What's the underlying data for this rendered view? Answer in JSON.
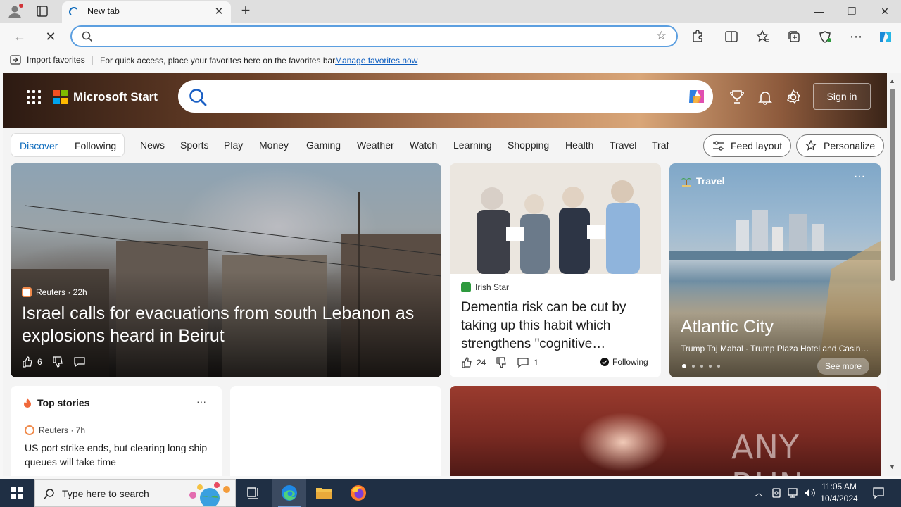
{
  "browser": {
    "tab_title": "New tab",
    "address_value": "",
    "favorites_bar": {
      "import_label": "Import favorites",
      "hint": "For quick access, place your favorites here on the favorites bar.",
      "manage_link": "Manage favorites now"
    }
  },
  "msn": {
    "brand": "Microsoft Start",
    "sign_in": "Sign in",
    "feed_tabs": [
      "Discover",
      "Following"
    ],
    "nav": [
      "News",
      "Sports",
      "Play",
      "Money",
      "Gaming",
      "Weather",
      "Watch",
      "Learning",
      "Shopping",
      "Health",
      "Travel",
      "Traf"
    ],
    "feed_layout": "Feed layout",
    "personalize": "Personalize"
  },
  "cards": {
    "hero": {
      "source": "Reuters · 22h",
      "headline": "Israel calls for evacuations from south Lebanon as explosions heard in Beirut",
      "likes": "6"
    },
    "dementia": {
      "source": "Irish Star",
      "headline": "Dementia risk can be cut by taking up this habit which strengthens \"cognitive…",
      "likes": "24",
      "comments": "1",
      "following": "Following"
    },
    "travel": {
      "label": "Travel",
      "title": "Atlantic City",
      "subtitle": "Trump Taj Mahal · Trump Plaza Hotel and Casino ...",
      "see_more": "See more"
    },
    "top_stories": {
      "label": "Top stories",
      "source": "Reuters · 7h",
      "headline": "US port strike ends, but clearing long ship queues will take time"
    },
    "watermark": "ANY RUN"
  },
  "taskbar": {
    "search_placeholder": "Type here to search",
    "time": "11:05 AM",
    "date": "10/4/2024"
  },
  "colors": {
    "accent": "#0f6cbd",
    "taskbar": "#1f2f44",
    "hero_band": "#b9825b"
  }
}
